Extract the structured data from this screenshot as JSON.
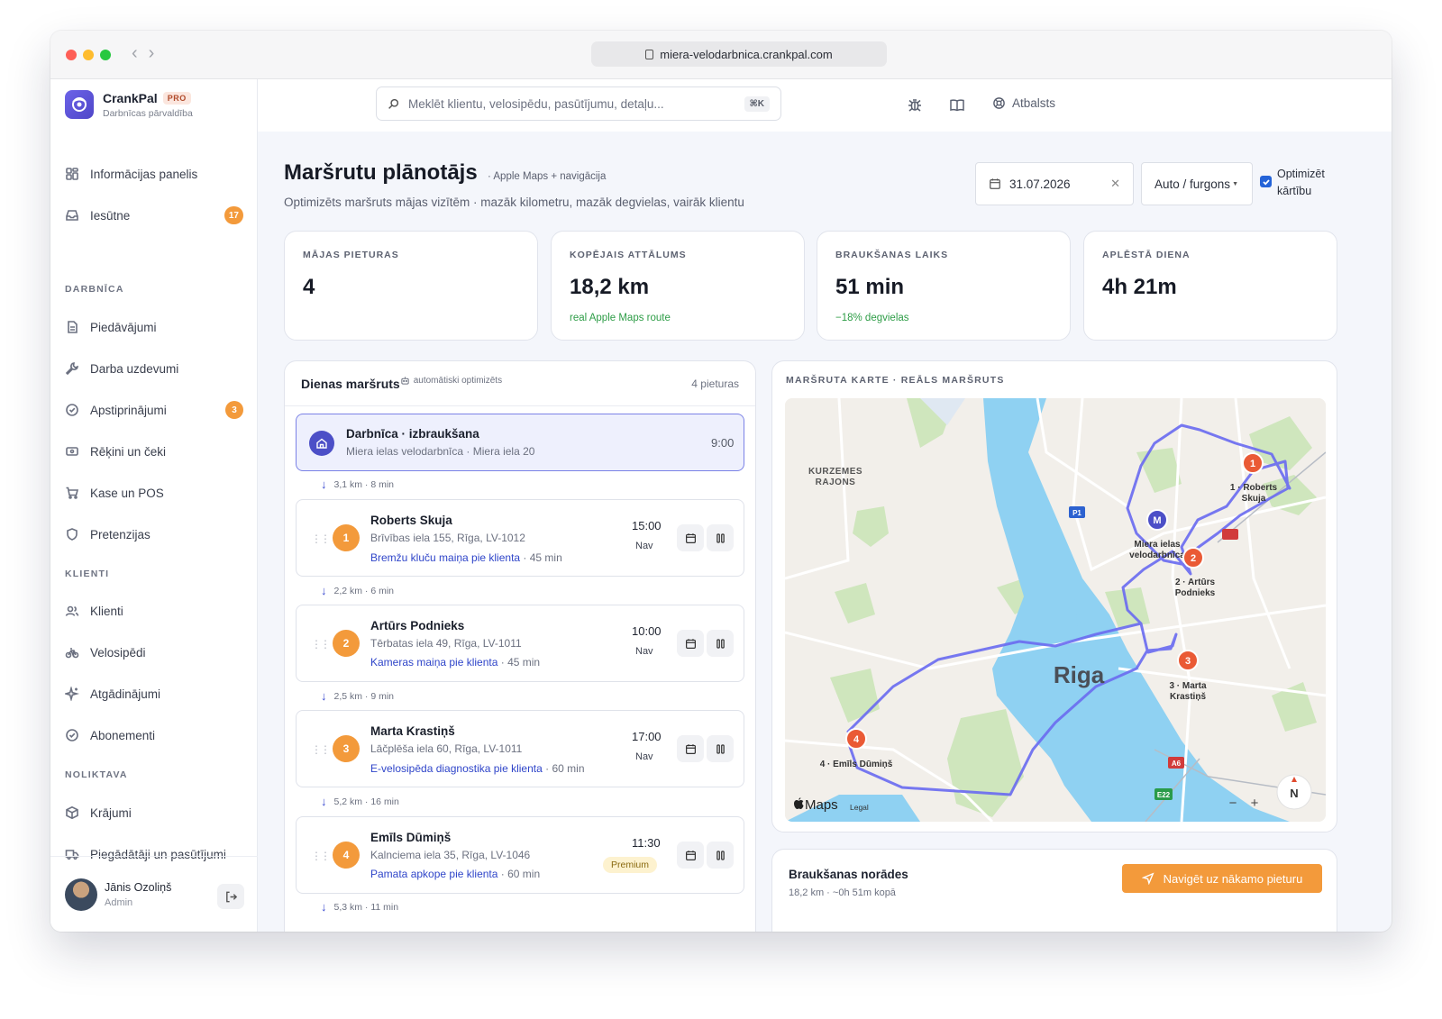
{
  "browser": {
    "url": "miera-velodarbnica.crankpal.com"
  },
  "brand": {
    "name": "CrankPal",
    "tier": "PRO",
    "subtitle": "Darbnīcas pārvaldība"
  },
  "search": {
    "placeholder": "Meklēt klientu, velosipēdu, pasūtījumu, detaļu...",
    "shortcut": "⌘K"
  },
  "topbar": {
    "support": "Atbalsts"
  },
  "sidebar": {
    "items": [
      {
        "label": "Informācijas panelis",
        "icon": "dashboard-icon"
      },
      {
        "label": "Iesūtne",
        "icon": "inbox-icon",
        "badge": "17"
      }
    ],
    "sections": [
      {
        "title": "DARBNĪCA",
        "items": [
          {
            "label": "Piedāvājumi",
            "icon": "document-icon"
          },
          {
            "label": "Darba uzdevumi",
            "icon": "wrench-icon"
          },
          {
            "label": "Apstiprinājumi",
            "icon": "check-circle-icon",
            "badge": "3"
          },
          {
            "label": "Rēķini un čeki",
            "icon": "receipt-icon"
          },
          {
            "label": "Kase un POS",
            "icon": "cart-icon"
          },
          {
            "label": "Pretenzijas",
            "icon": "shield-icon"
          }
        ]
      },
      {
        "title": "KLIENTI",
        "items": [
          {
            "label": "Klienti",
            "icon": "users-icon"
          },
          {
            "label": "Velosipēdi",
            "icon": "bike-icon"
          },
          {
            "label": "Atgādinājumi",
            "icon": "sparkle-icon"
          },
          {
            "label": "Abonementi",
            "icon": "check-circle-icon"
          }
        ]
      },
      {
        "title": "NOLIKTAVA",
        "items": [
          {
            "label": "Krājumi",
            "icon": "box-icon"
          },
          {
            "label": "Piegādātāji un pasūtījumi",
            "icon": "truck-icon"
          }
        ]
      }
    ]
  },
  "user": {
    "name": "Jānis Ozoliņš",
    "role": "Admin"
  },
  "page": {
    "title": "Maršrutu plānotājs",
    "tag": "· Apple Maps + navigācija",
    "subtitle": "Optimizēts maršruts mājas vizītēm · mazāk kilometru, mazāk degvielas, vairāk klientu",
    "date": "31.07.2026",
    "vehicle": "Auto / furgons",
    "optimize_label_1": "Optimizēt",
    "optimize_label_2": "kārtību",
    "optimize_checked": true
  },
  "stats": [
    {
      "label": "MĀJAS PIETURAS",
      "value": "4",
      "sub": ""
    },
    {
      "label": "KOPĒJAIS ATTĀLUMS",
      "value": "18,2 km",
      "sub": "real Apple Maps route"
    },
    {
      "label": "BRAUKŠANAS LAIKS",
      "value": "51 min",
      "sub": "−18% degvielas"
    },
    {
      "label": "APLĒSTĀ DIENA",
      "value": "4h 21m",
      "sub": ""
    }
  ],
  "route": {
    "title": "Dienas maršruts",
    "auto": "automātiski optimizēts",
    "count": "4 pieturas",
    "start": {
      "name": "Darbnīca · izbraukšana",
      "address": "Miera ielas velodarbnīca · Miera iela 20",
      "time": "9:00"
    },
    "legs": [
      "3,1 km · 8 min",
      "2,2 km · 6 min",
      "2,5 km · 9 min",
      "5,2 km · 16 min",
      "5,3 km · 11 min"
    ],
    "stops": [
      {
        "num": "1",
        "name": "Roberts Skuja",
        "address": "Brīvības iela 155, Rīga, LV-1012",
        "service": "Bremžu kluču maiņa pie klienta",
        "duration": "· 45 min",
        "time": "15:00",
        "day": "Nav"
      },
      {
        "num": "2",
        "name": "Artūrs Podnieks",
        "address": "Tērbatas iela 49, Rīga, LV-1011",
        "service": "Kameras maiņa pie klienta",
        "duration": "· 45 min",
        "time": "10:00",
        "day": "Nav"
      },
      {
        "num": "3",
        "name": "Marta Krastiņš",
        "address": "Lāčplēša iela 60, Rīga, LV-1011",
        "service": "E-velosipēda diagnostika pie klienta",
        "duration": "· 60 min",
        "time": "17:00",
        "day": "Nav"
      },
      {
        "num": "4",
        "name": "Emīls Dūmiņš",
        "address": "Kalnciema iela 35, Rīga, LV-1046",
        "service": "Pamata apkope pie klienta",
        "duration": "· 60 min",
        "time": "11:30",
        "badge": "Premium"
      }
    ]
  },
  "map": {
    "title": "MARŠRUTA KARTE · REĀLS MARŠRUTS",
    "district": [
      "KURZEMES",
      "RAJONS"
    ],
    "city": "Riga",
    "home_marker": "M",
    "home_label": [
      "Miera ielas",
      "velodarbnīca"
    ],
    "marker_labels": [
      [
        "1 · Roberts",
        "Skuja"
      ],
      [
        "2 · Artūrs",
        "Podnieks"
      ],
      [
        "3 · Marta",
        "Krastiņš"
      ],
      [
        "4 · Emīls Dūmiņš"
      ]
    ],
    "road_shields": [
      "P1",
      "A6",
      "E22"
    ],
    "brand": "Maps",
    "legal": "Legal",
    "compass": "N",
    "zoom_out": "−",
    "zoom_in": "+"
  },
  "directions": {
    "title": "Braukšanas norādes",
    "sub": "18,2 km · ~0h 51m kopā",
    "button": "Navigēt uz nākamo pieturu"
  }
}
